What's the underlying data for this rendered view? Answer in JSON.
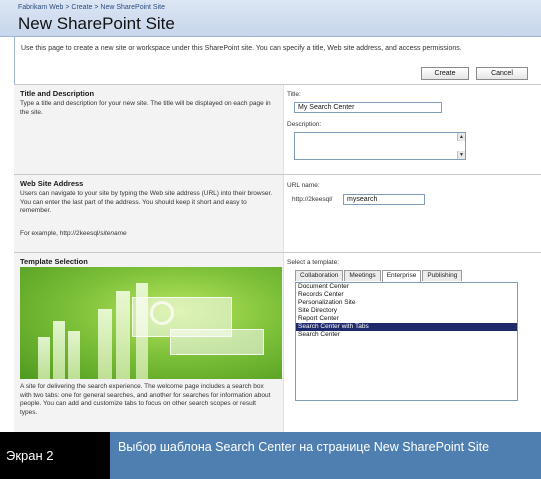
{
  "breadcrumb": {
    "items": [
      "Fabrikam Web",
      "Create",
      "New SharePoint Site"
    ],
    "separator": ">"
  },
  "page_title": "New SharePoint Site",
  "intro_text": "Use this page to create a new site or workspace under this SharePoint site. You can specify a title, Web site address, and access permissions.",
  "actions": {
    "create_label": "Create",
    "cancel_label": "Cancel"
  },
  "title_section": {
    "heading": "Title and Description",
    "description": "Type a title and description for your new site. The title will be displayed on each page in the site.",
    "title_label": "Title:",
    "title_value": "My Search Center",
    "description_label": "Description:"
  },
  "address_section": {
    "heading": "Web Site Address",
    "description": "Users can navigate to your site by typing the Web site address (URL) into their browser. You can enter the last part of the address. You should keep it short and easy to remember.",
    "example_prefix": "For example, http://2keesql/",
    "example_suffix": "sitename",
    "url_label": "URL name:",
    "url_prefix": "http://2keesql/",
    "url_value": "mysearch"
  },
  "template_section": {
    "heading": "Template Selection",
    "description": "A site for delivering the search experience. The welcome page includes a search box with two tabs: one for general searches, and another for searches for information about people. You can add and customize tabs to focus on other search scopes or result types.",
    "select_label": "Select a template:",
    "tabs": [
      "Collaboration",
      "Meetings",
      "Enterprise",
      "Publishing"
    ],
    "active_tab": "Enterprise",
    "templates": [
      "Document Center",
      "Records Center",
      "Personalization Site",
      "Site Directory",
      "Report Center",
      "Search Center with Tabs",
      "Search Center"
    ],
    "selected_template": "Search Center with Tabs"
  },
  "caption": {
    "label": "Экран 2",
    "text": "Выбор шаблона Search Center на странице New SharePoint Site"
  },
  "colors": {
    "header_bg": "#c7d6ec",
    "caption_bg": "#4f7fb0",
    "selection_bg": "#1f2a6d",
    "preview_green": "#7fc23a"
  }
}
